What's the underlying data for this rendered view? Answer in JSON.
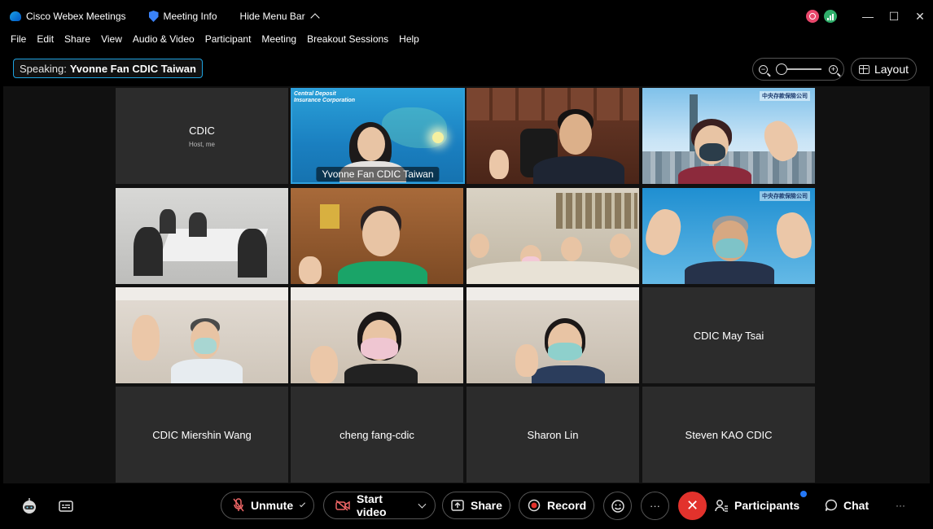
{
  "titlebar": {
    "app_name": "Cisco Webex Meetings",
    "meeting_info": "Meeting Info",
    "hide_menu": "Hide Menu Bar",
    "minimize": "—",
    "maximize": "☐",
    "close": "✕"
  },
  "menu": [
    "File",
    "Edit",
    "Share",
    "View",
    "Audio & Video",
    "Participant",
    "Meeting",
    "Breakout Sessions",
    "Help"
  ],
  "speaking": {
    "label": "Speaking:",
    "name": "Yvonne Fan CDIC Taiwan"
  },
  "layout_label": "Layout",
  "zoom": {
    "minus": "−",
    "plus": "+"
  },
  "tiles": {
    "cdic_host": {
      "name": "CDIC",
      "sub": "Host, me"
    },
    "yvonne": {
      "name": "Yvonne Fan CDIC Taiwan",
      "banner": "Central Deposit\nInsurance Corporation"
    },
    "logo_text": "中央存款保險公司",
    "may_tsai": "CDIC May Tsai",
    "miershin": "CDIC Miershin Wang",
    "cheng": "cheng fang-cdic",
    "sharon": "Sharon Lin",
    "steven": "Steven KAO CDIC"
  },
  "controls": {
    "unmute": "Unmute",
    "start_video": "Start video",
    "share": "Share",
    "record": "Record",
    "more": "···",
    "end": "✕",
    "participants": "Participants",
    "chat": "Chat",
    "overflow": "···"
  },
  "colors": {
    "accent": "#1da2e0",
    "end_call": "#e2322c",
    "notification": "#2478f7"
  }
}
